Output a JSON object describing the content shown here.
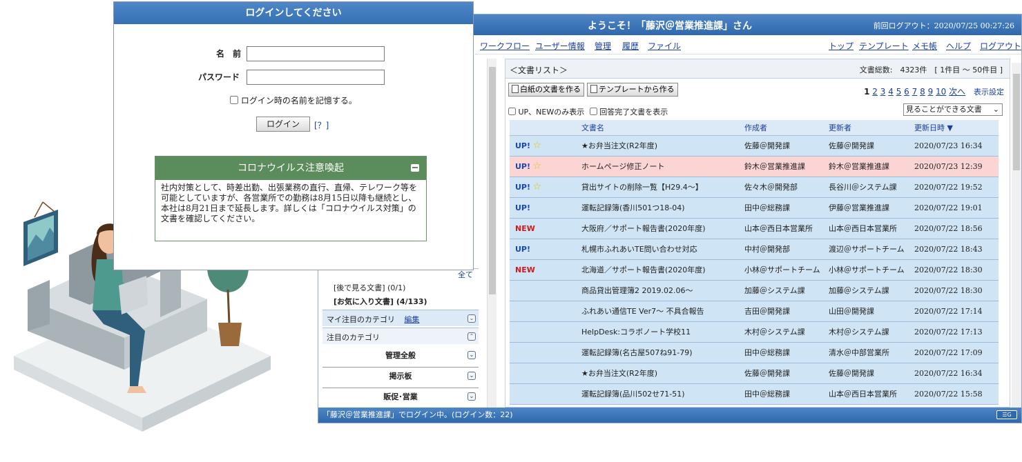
{
  "main": {
    "title": "ようこそ！「藤沢＠営業推進課」さん",
    "last_logout": "前回ログアウト：2020/07/25 00:27:26",
    "menu_left": [
      "ワークフロー",
      "ユーザー情報",
      "管理",
      "履歴",
      "ファイル"
    ],
    "menu_right": [
      "トップ",
      "テンプレート",
      "メモ帳",
      "ヘルプ",
      "ログアウト"
    ]
  },
  "sidebar": {
    "all_link": "全て",
    "later_docs": "[後で見る文書] (0/1)",
    "favorite_docs": "[お気に入り文書] (4/133)",
    "my_category": "マイ注目のカテゴリ",
    "edit_link": "編集",
    "featured_category": "注目のカテゴリ",
    "categories": [
      "管理全般",
      "掲示板",
      "販促･営業"
    ]
  },
  "doclist": {
    "heading": "＜文書リスト＞",
    "total": "文書総数:　4323件　[ 1件目 〜 50件目 ]",
    "new_blank_button": "白紙の文書を作る",
    "new_template_button": "テンプレートから作る",
    "pages": [
      "1",
      "2",
      "3",
      "4",
      "5",
      "6",
      "7",
      "8",
      "9",
      "10"
    ],
    "next_link": "次へ",
    "display_settings_link": "表示設定",
    "filter_up_new": "UP、NEWのみ表示",
    "filter_answered": "回答完了文書を表示",
    "view_select": "見ることができる文書",
    "columns": {
      "name": "文書名",
      "author": "作成者",
      "updater": "更新者",
      "updated": "更新日時 ▼"
    },
    "rows": [
      {
        "badge": "UP!",
        "star": true,
        "tint": "blue",
        "name": "★お弁当注文(R2年度)",
        "author": "佐藤＠開発課",
        "updater": "佐藤＠開発課",
        "updated": "2020/07/23 16:34"
      },
      {
        "badge": "UP!",
        "star": true,
        "tint": "pink",
        "name": "ホームページ修正ノート",
        "author": "鈴木＠営業推進課",
        "updater": "鈴木＠営業推進課",
        "updated": "2020/07/23 12:39"
      },
      {
        "badge": "UP!",
        "star": true,
        "tint": "blue",
        "name": "貸出サイトの削除一覧【H29.4〜】",
        "author": "佐々木＠開発部",
        "updater": "長谷川＠システム課",
        "updated": "2020/07/22 19:52"
      },
      {
        "badge": "UP!",
        "star": false,
        "tint": "blue",
        "name": "運転記録簿(香川501つ18-04)",
        "author": "田中＠総務課",
        "updater": "伊藤＠営業推進課",
        "updated": "2020/07/22 19:01"
      },
      {
        "badge": "NEW",
        "star": false,
        "tint": "blue",
        "name": "大阪府／サポート報告書(2020年度)",
        "author": "山本＠西日本営業所",
        "updater": "山本＠西日本営業所",
        "updated": "2020/07/22 18:56"
      },
      {
        "badge": "UP!",
        "star": false,
        "tint": "blue",
        "name": "札幌市ふれあいTE問い合わせ対応",
        "author": "中村＠開発部",
        "updater": "渡辺＠サポートチーム",
        "updated": "2020/07/22 18:43"
      },
      {
        "badge": "NEW",
        "star": false,
        "tint": "blue",
        "name": "北海道／サポート報告書(2020年度)",
        "author": "小林＠サポートチーム",
        "updater": "小林＠サポートチーム",
        "updated": "2020/07/22 18:30"
      },
      {
        "badge": "",
        "star": false,
        "tint": "blue",
        "name": "商品貸出管理簿2 2019.02.06〜",
        "author": "加藤＠システム課",
        "updater": "加藤＠システム課",
        "updated": "2020/07/22 18:30"
      },
      {
        "badge": "",
        "star": false,
        "tint": "blue",
        "name": "ふれあい通信TE Ver7〜 不具合報告",
        "author": "吉田＠開発課",
        "updater": "山田＠開発課",
        "updated": "2020/07/22 17:14"
      },
      {
        "badge": "",
        "star": false,
        "tint": "blue",
        "name": "HelpDesk:コラボノート学校11",
        "author": "木村＠システム課",
        "updater": "木村＠システム課",
        "updated": "2020/07/22 17:13"
      },
      {
        "badge": "",
        "star": false,
        "tint": "blue",
        "name": "運転記録簿(名古屋507ね91-79)",
        "author": "田中＠総務課",
        "updater": "清水＠中部営業所",
        "updated": "2020/07/22 17:09"
      },
      {
        "badge": "",
        "star": false,
        "tint": "blue",
        "name": "★お弁当注文(R2年度)",
        "author": "佐藤＠開発課",
        "updater": "佐藤＠開発課",
        "updated": "2020/07/22 16:34"
      },
      {
        "badge": "",
        "star": false,
        "tint": "blue",
        "name": "運転記録簿(品川502せ71-51)",
        "author": "田中＠総務課",
        "updater": "山本＠西日本営業所",
        "updated": "2020/07/22 15:58"
      }
    ]
  },
  "status": {
    "text": "「藤沢＠営業推進課」でログイン中。(ログイン数：22)",
    "icon": "gadget-icon"
  },
  "login": {
    "title": "ログインしてください",
    "name_label": "名　前",
    "password_label": "パスワード",
    "name_value": "",
    "password_value": "",
    "remember_label": "ログイン時の名前を記憶する。",
    "login_button": "ログイン",
    "help_link": "[？]"
  },
  "notice": {
    "title": "コロナウイルス注意喚起",
    "body": "社内対策として、時差出勤、出張業務の直行、直帰、テレワーク等を可能としていますが、各営業所での勤務は8月15日以降も継続とし、本社は8月21日まで延長します。詳しくは「コロナウイルス対策」の文書を確認してください。"
  },
  "colors": {
    "title_blue": "#3470b3",
    "notice_green": "#5b8c5b",
    "row_blue": "#cfe4f4",
    "row_pink": "#fbd4d4",
    "up_badge": "#1846b4",
    "new_badge": "#d11a1a"
  }
}
